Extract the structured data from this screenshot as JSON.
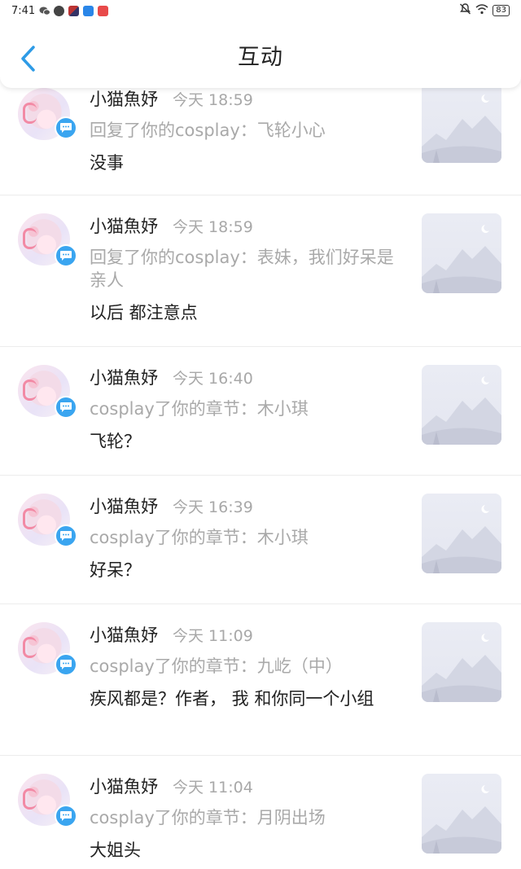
{
  "status_bar": {
    "time": "7:41",
    "battery": "83",
    "left_icons": [
      "wechat-icon",
      "app-icon-globe",
      "app-icon-game",
      "app-icon-cloud",
      "app-icon-red"
    ],
    "right_icons": [
      "mute-icon",
      "wifi-icon",
      "battery-icon"
    ]
  },
  "header": {
    "title": "互动",
    "back_icon": "chevron-left-icon"
  },
  "colors": {
    "accent": "#3aa5f0",
    "muted_text": "#a9a9a9",
    "primary_text": "#222222"
  },
  "items": [
    {
      "user": "小猫魚妤",
      "time": "今天 18:59",
      "context": "回复了你的cosplay：飞轮小心",
      "message": "没事"
    },
    {
      "user": "小猫魚妤",
      "time": "今天 18:59",
      "context": "回复了你的cosplay：表妹，我们好呆是亲人",
      "message": "以后  都注意点"
    },
    {
      "user": "小猫魚妤",
      "time": "今天 16:40",
      "context": "cosplay了你的章节：木小琪",
      "message": "飞轮？"
    },
    {
      "user": "小猫魚妤",
      "time": "今天 16:39",
      "context": "cosplay了你的章节：木小琪",
      "message": "好呆？"
    },
    {
      "user": "小猫魚妤",
      "time": "今天 11:09",
      "context": "cosplay了你的章节：九屹（中）",
      "message": "疾风都是？作者，  我 和你同一个小组"
    },
    {
      "user": "小猫魚妤",
      "time": "今天 11:04",
      "context": "cosplay了你的章节：月阴出场",
      "message": "大姐头"
    }
  ]
}
